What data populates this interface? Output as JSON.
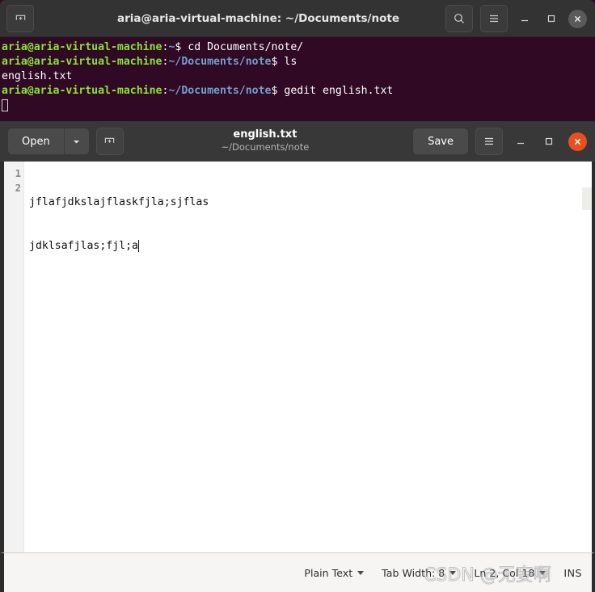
{
  "terminal": {
    "title": "aria@aria-virtual-machine: ~/Documents/note",
    "new_tab_icon": "new-tab-icon",
    "search_icon": "search-icon",
    "menu_icon": "hamburger-menu-icon",
    "minimize_icon": "minimize-icon",
    "maximize_icon": "maximize-icon",
    "close_icon": "close-icon",
    "colors": {
      "background": "#300a24",
      "titlebar": "#333333",
      "user_host": "#8ae234",
      "path": "#729fcf",
      "text": "#ffffff"
    },
    "lines": [
      {
        "user": "aria@aria-virtual-machine",
        "colon": ":",
        "path": "~",
        "prompt": "$",
        "command": " cd Documents/note/"
      },
      {
        "user": "aria@aria-virtual-machine",
        "colon": ":",
        "path": "~/Documents/note",
        "prompt": "$",
        "command": " ls"
      },
      {
        "plain": "english.txt"
      },
      {
        "user": "aria@aria-virtual-machine",
        "colon": ":",
        "path": "~/Documents/note",
        "prompt": "$",
        "command": " gedit english.txt"
      }
    ]
  },
  "gedit": {
    "open_label": "Open",
    "open_dropdown_icon": "chevron-down-icon",
    "new_tab_icon": "new-tab-icon",
    "title": "english.txt",
    "subtitle": "~/Documents/note",
    "save_label": "Save",
    "menu_icon": "hamburger-menu-icon",
    "minimize_icon": "minimize-icon",
    "maximize_icon": "maximize-icon",
    "close_icon": "close-icon",
    "close_color": "#e8501f",
    "document": {
      "line_numbers": [
        "1",
        "2"
      ],
      "lines": [
        "jflafjdkslajflaskfjla;sjflas",
        "jdklsafjlas;fjl;a"
      ]
    },
    "statusbar": {
      "language": "Plain Text",
      "tab_width": "Tab Width: 8",
      "position": "Ln 2, Col 18",
      "insert_mode": "INS"
    }
  },
  "watermark": {
    "text": "CSDN @无妄啊"
  }
}
